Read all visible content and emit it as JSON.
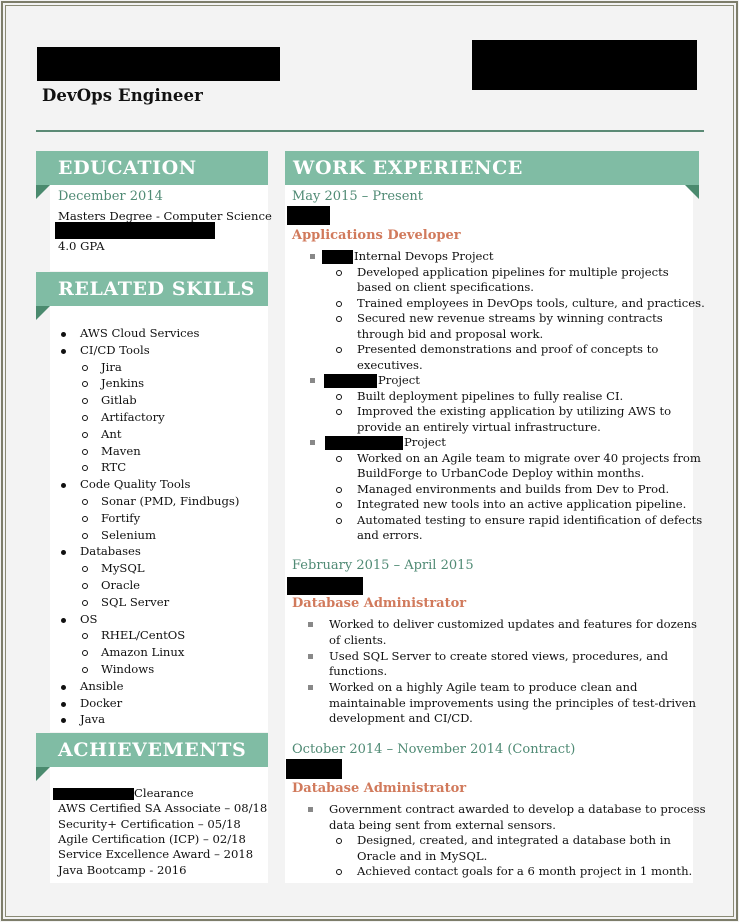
{
  "header": {
    "title": "DevOps Engineer"
  },
  "education": {
    "heading": "EDUCATION",
    "date": "December 2014",
    "degree": "Masters Degree - Computer Science",
    "gpa": "4.0 GPA"
  },
  "skills": {
    "heading": "RELATED SKILLS",
    "items": [
      {
        "level": 1,
        "label": "AWS Cloud Services"
      },
      {
        "level": 1,
        "label": "CI/CD Tools"
      },
      {
        "level": 2,
        "label": "Jira"
      },
      {
        "level": 2,
        "label": "Jenkins"
      },
      {
        "level": 2,
        "label": "Gitlab"
      },
      {
        "level": 2,
        "label": "Artifactory"
      },
      {
        "level": 2,
        "label": "Ant"
      },
      {
        "level": 2,
        "label": "Maven"
      },
      {
        "level": 2,
        "label": "RTC"
      },
      {
        "level": 1,
        "label": "Code Quality Tools"
      },
      {
        "level": 2,
        "label": "Sonar (PMD, Findbugs)"
      },
      {
        "level": 2,
        "label": "Fortify"
      },
      {
        "level": 2,
        "label": "Selenium"
      },
      {
        "level": 1,
        "label": "Databases"
      },
      {
        "level": 2,
        "label": "MySQL"
      },
      {
        "level": 2,
        "label": "Oracle"
      },
      {
        "level": 2,
        "label": "SQL Server"
      },
      {
        "level": 1,
        "label": "OS"
      },
      {
        "level": 2,
        "label": "RHEL/CentOS"
      },
      {
        "level": 2,
        "label": "Amazon Linux"
      },
      {
        "level": 2,
        "label": "Windows"
      },
      {
        "level": 1,
        "label": "Ansible"
      },
      {
        "level": 1,
        "label": "Docker"
      },
      {
        "level": 1,
        "label": "Java"
      }
    ]
  },
  "achievements": {
    "heading": "ACHIEVEMENTS",
    "items": [
      "Clearance",
      "AWS Certified SA Associate – 08/18",
      "Security+ Certification – 05/18",
      "Agile Certification (ICP) – 02/18",
      "Service Excellence Award – 2018",
      "Java Bootcamp - 2016"
    ]
  },
  "work": {
    "heading": "WORK EXPERIENCE",
    "jobs": [
      {
        "date": "May 2015 – Present",
        "role": "Applications Developer",
        "projects": [
          {
            "name": "Internal Devops Project",
            "bullets": [
              "Developed application pipelines for multiple projects|based on client specifications.",
              "Trained employees in DevOps tools, culture, and practices.",
              "Secured new revenue streams by winning contracts|through bid and proposal work.",
              "Presented demonstrations and proof of concepts to|executives."
            ]
          },
          {
            "name": "Project",
            "bullets": [
              "Built deployment pipelines to fully realise CI.",
              "Improved the existing application by utilizing AWS to|provide an entirely virtual infrastructure."
            ]
          },
          {
            "name": "Project",
            "bullets": [
              "Worked on an Agile team to migrate over 40 projects from|BuildForge to UrbanCode Deploy within months.",
              "Managed environments and builds from Dev to Prod.",
              "Integrated new tools into an active application pipeline.",
              "Automated testing to ensure rapid identification of defects|and errors."
            ]
          }
        ]
      },
      {
        "date": "February 2015 – April 2015",
        "role": "Database Administrator",
        "bullets": [
          "Worked to deliver customized updates and features for dozens|of clients.",
          "Used SQL Server to create stored views, procedures, and|functions.",
          "Worked on a highly Agile team to produce clean and|maintainable improvements using the principles of test-driven|development and CI/CD."
        ]
      },
      {
        "date": "October 2014 – November 2014 (Contract)",
        "role": "Database Administrator",
        "bullets": [
          "Government contract awarded to develop a database to process|data being sent from external sensors."
        ],
        "sub_bullets": [
          "Designed, created, and integrated a database both in|Oracle and in MySQL.",
          "Achieved contact goals for a 6 month project in 1 month."
        ]
      }
    ]
  },
  "colors": {
    "ribbon": "#80bca4",
    "ribbon_fold": "#4a8a6e",
    "date": "#4f8a74",
    "role": "#d17a5c",
    "rule": "#5b8a75"
  }
}
